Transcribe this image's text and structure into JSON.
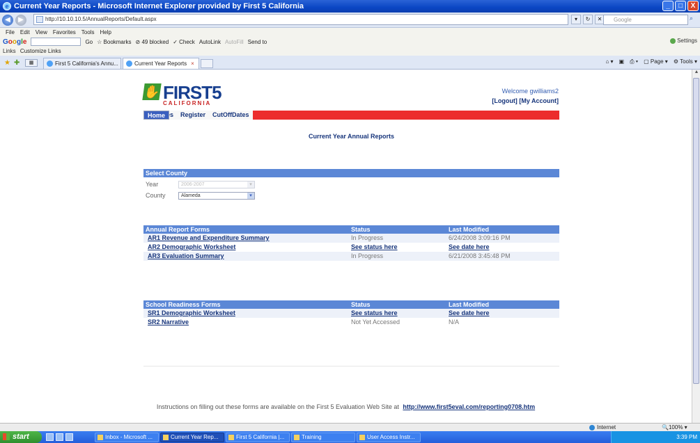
{
  "window": {
    "title": "Current Year Reports - Microsoft Internet Explorer provided by First 5 California",
    "minimize": "_",
    "maximize": "□",
    "close": "X"
  },
  "address": {
    "url": "http://10.10.10.5/AnnualReports/Default.aspx",
    "search_placeholder": "Google"
  },
  "menu": [
    "File",
    "Edit",
    "View",
    "Favorites",
    "Tools",
    "Help"
  ],
  "google_toolbar": {
    "go": "Go",
    "bookmarks": "Bookmarks",
    "blocked": "49 blocked",
    "check": "Check",
    "autolink": "AutoLink",
    "autofill": "AutoFill",
    "send_to": "Send to",
    "settings": "Settings"
  },
  "links_bar": {
    "label": "Links",
    "item": "Customize Links"
  },
  "tabs": [
    {
      "label": "First 5 California's Annu..."
    },
    {
      "label": "Current Year Reports"
    }
  ],
  "command_bar": {
    "page": "Page",
    "tools": "Tools"
  },
  "site": {
    "logo_text": "FIRST5",
    "logo_sub": "CALIFORNIA",
    "welcome": "Welcome gwilliams2",
    "logout": "[Logout]",
    "my_account": "[My Account]",
    "nav": [
      "Home",
      "Archives",
      "Register",
      "CutOffDates"
    ],
    "page_title": "Current Year Annual Reports"
  },
  "select_county": {
    "header": "Select County",
    "year_label": "Year",
    "year_value": "2006-2007",
    "county_label": "County",
    "county_value": "Alameda"
  },
  "annual_reports": {
    "headers": [
      "Annual Report Forms",
      "Status",
      "Last Modified"
    ],
    "rows": [
      {
        "form": "AR1 Revenue and Expenditure Summary",
        "status": "In Progress",
        "modified": "6/24/2008 3:09:16 PM"
      },
      {
        "form": "AR2 Demographic Worksheet",
        "status": "See status here",
        "modified": "See date here"
      },
      {
        "form": "AR3 Evaluation Summary",
        "status": "In Progress",
        "modified": "6/21/2008 3:45:48 PM"
      }
    ]
  },
  "school_readiness": {
    "headers": [
      "School Readiness Forms",
      "Status",
      "Last Modified"
    ],
    "rows": [
      {
        "form": "SR1 Demographic Worksheet",
        "status": "See status here",
        "modified": "See date here"
      },
      {
        "form": "SR2 Narrative",
        "status": "Not Yet Accessed",
        "modified": "N/A"
      }
    ]
  },
  "footer": {
    "text": "Instructions on filling out these forms are available on the First 5 Evaluation Web Site at",
    "link": "http://www.first5eval.com/reporting0708.htm"
  },
  "status_bar": {
    "zone": "Internet",
    "zoom": "100%"
  },
  "taskbar": {
    "start": "start",
    "tasks": [
      "Inbox - Microsoft ...",
      "Current Year Rep...",
      "First 5 California |...",
      "Training",
      "User Access Instr..."
    ],
    "clock": "3:39 PM"
  }
}
